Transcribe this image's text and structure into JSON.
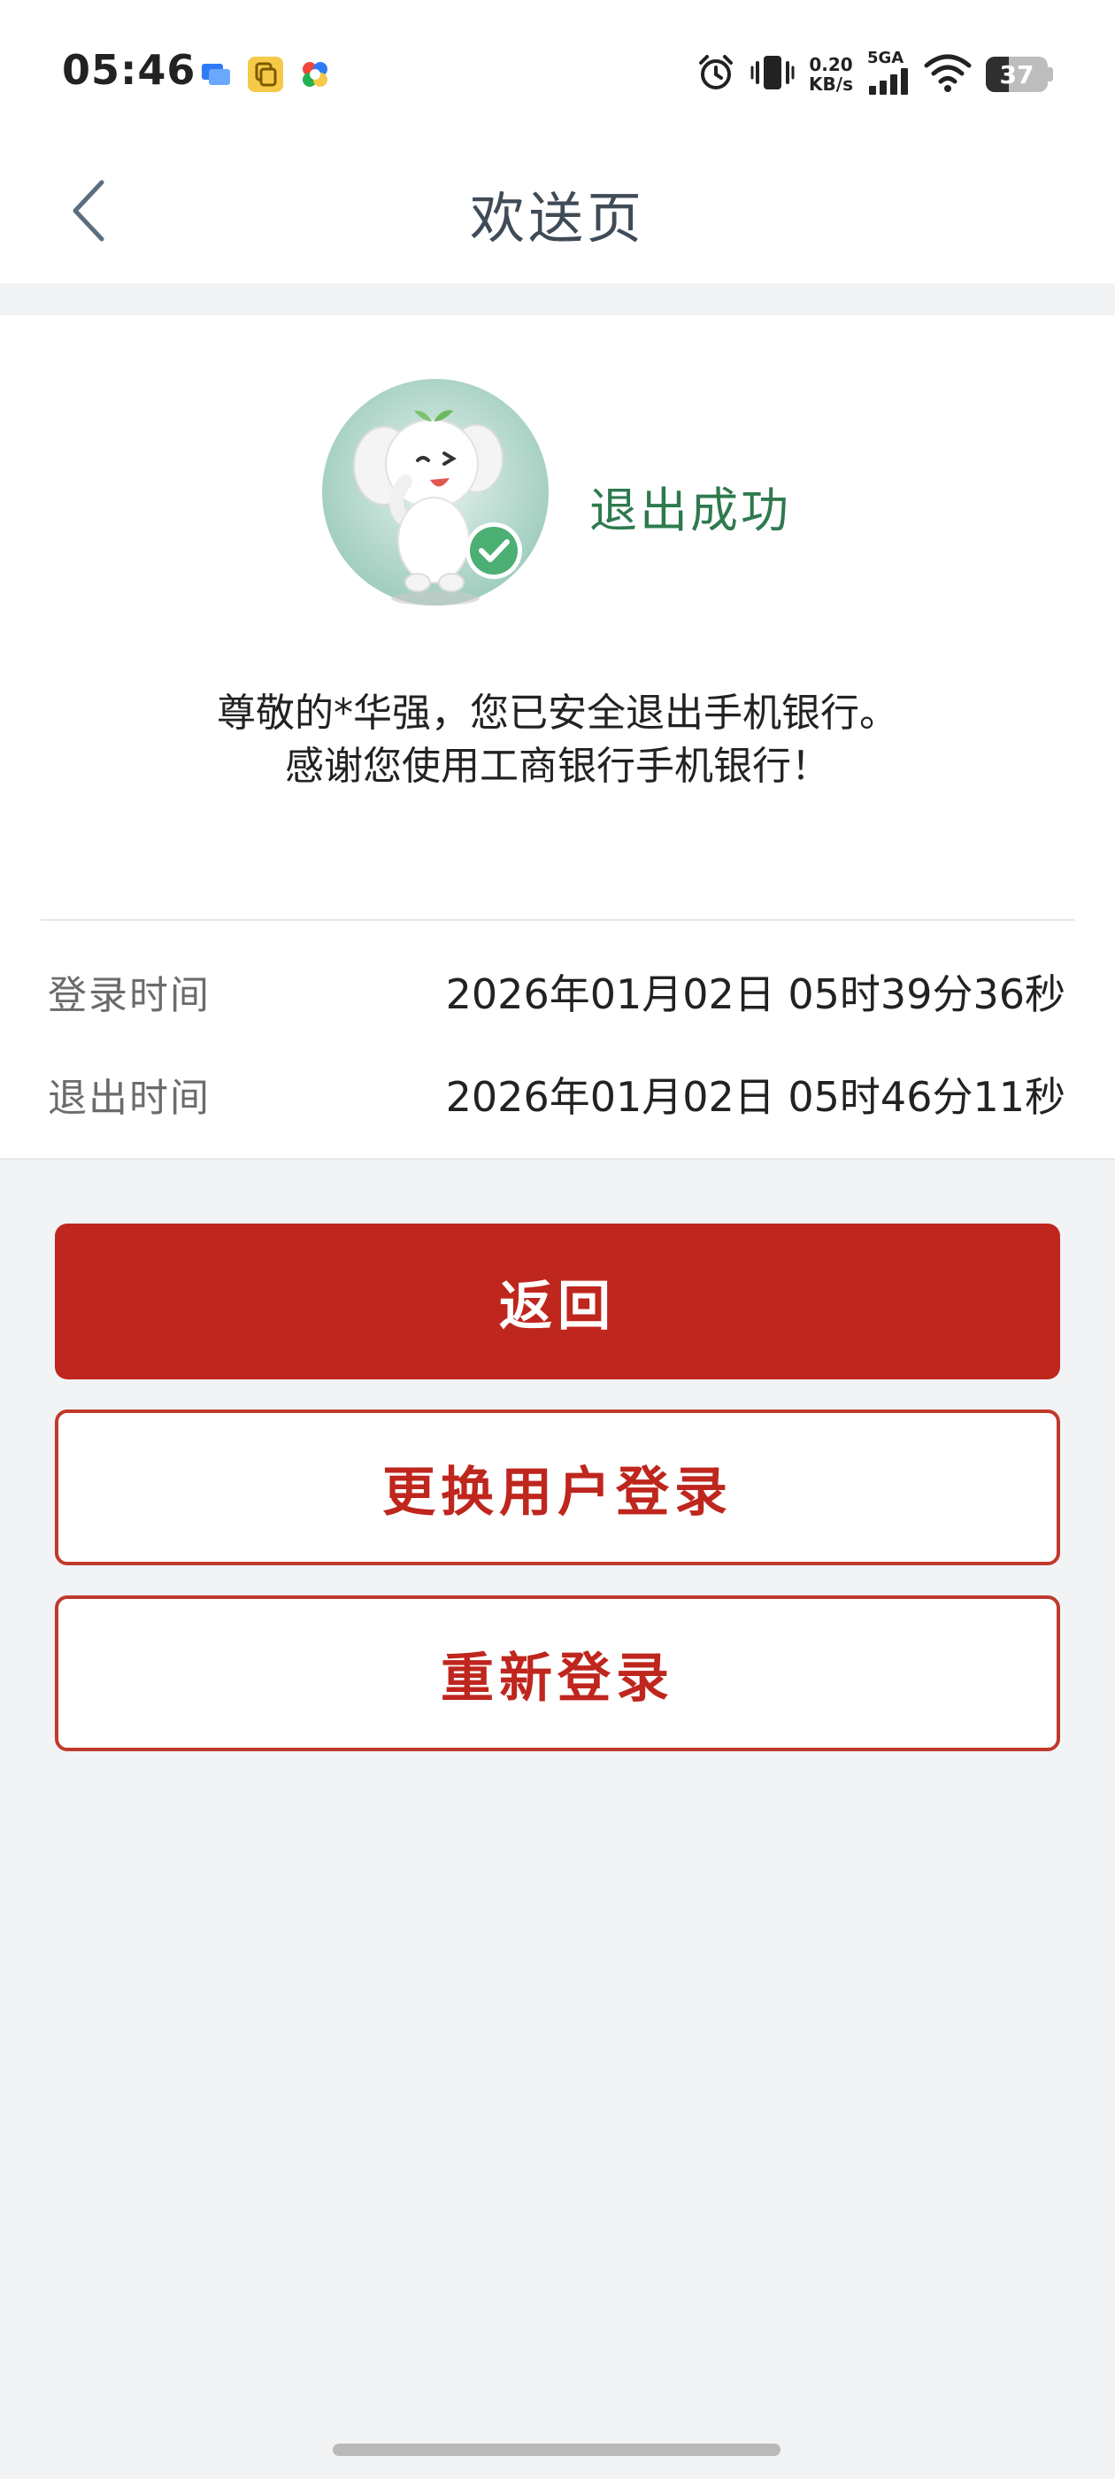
{
  "status_bar": {
    "time": "05:46",
    "net_speed_value": "0.20",
    "net_speed_unit": "KB/s",
    "network": "5GA",
    "battery": "37",
    "battery_level": 0.37,
    "icons": [
      "message-app-icon",
      "copy-app-icon",
      "pinwheel-app-icon",
      "alarm-icon",
      "vibrate-icon",
      "signal-icon",
      "wifi-icon",
      "battery-icon"
    ]
  },
  "nav": {
    "title": "欢送页",
    "back_icon": "chevron-left-icon"
  },
  "logout": {
    "status_text": "退出成功",
    "message_line1": "尊敬的*华强，您已安全退出手机银行。",
    "message_line2": "感谢您使用工商银行手机银行！"
  },
  "info": {
    "login_label": "登录时间",
    "login_value": "2026年01月02日 05时39分36秒",
    "logout_label": "退出时间",
    "logout_value": "2026年01月02日 05时46分11秒"
  },
  "buttons": {
    "back_label": "返回",
    "switch_user_label": "更换用户登录",
    "relogin_label": "重新登录"
  },
  "colors": {
    "brand_red": "#bf261e",
    "success_green": "#2e7a4e",
    "background": "#f2f3f5"
  }
}
